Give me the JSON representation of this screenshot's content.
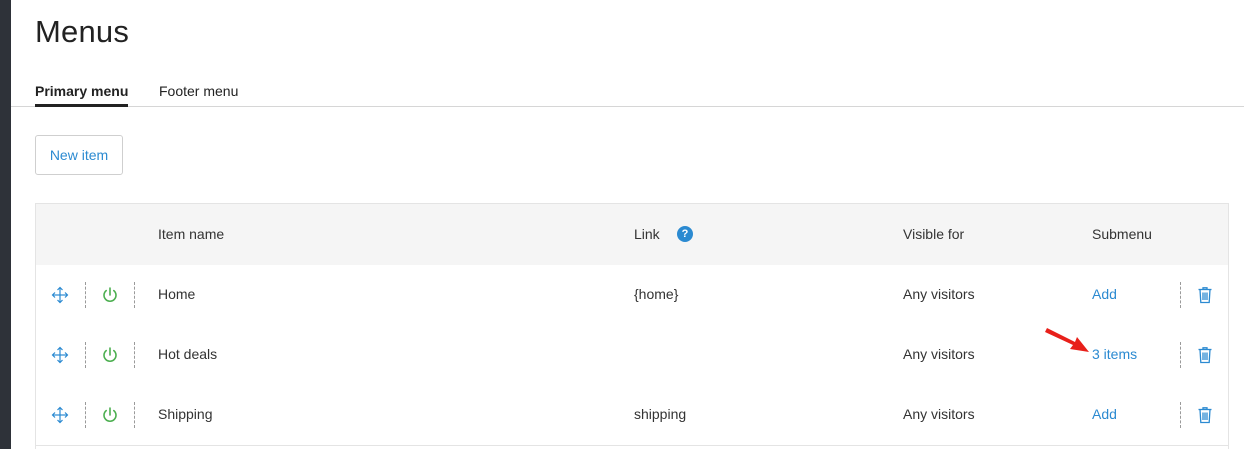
{
  "page": {
    "title": "Menus"
  },
  "tabs": [
    {
      "label": "Primary menu",
      "active": true
    },
    {
      "label": "Footer menu",
      "active": false
    }
  ],
  "toolbar": {
    "new_item_label": "New item"
  },
  "table": {
    "headers": {
      "item_name": "Item name",
      "link": "Link",
      "link_help": "?",
      "visible_for": "Visible for",
      "submenu": "Submenu"
    },
    "rows": [
      {
        "name": "Home",
        "link": "{home}",
        "visible_for": "Any visitors",
        "submenu": "Add",
        "enabled": true
      },
      {
        "name": "Hot deals",
        "link": "",
        "visible_for": "Any visitors",
        "submenu": "3 items",
        "enabled": true
      },
      {
        "name": "Shipping",
        "link": "shipping",
        "visible_for": "Any visitors",
        "submenu": "Add",
        "enabled": true
      }
    ]
  },
  "icons": {
    "move": "move-arrows-icon",
    "power": "power-icon",
    "trash": "trash-icon",
    "help": "help-icon",
    "annotation": "red-arrow-annotation"
  },
  "colors": {
    "accent": "#2b8ad1",
    "power_on": "#4caf50",
    "annotation": "#e8201a",
    "sidebar": "#2e3239"
  }
}
